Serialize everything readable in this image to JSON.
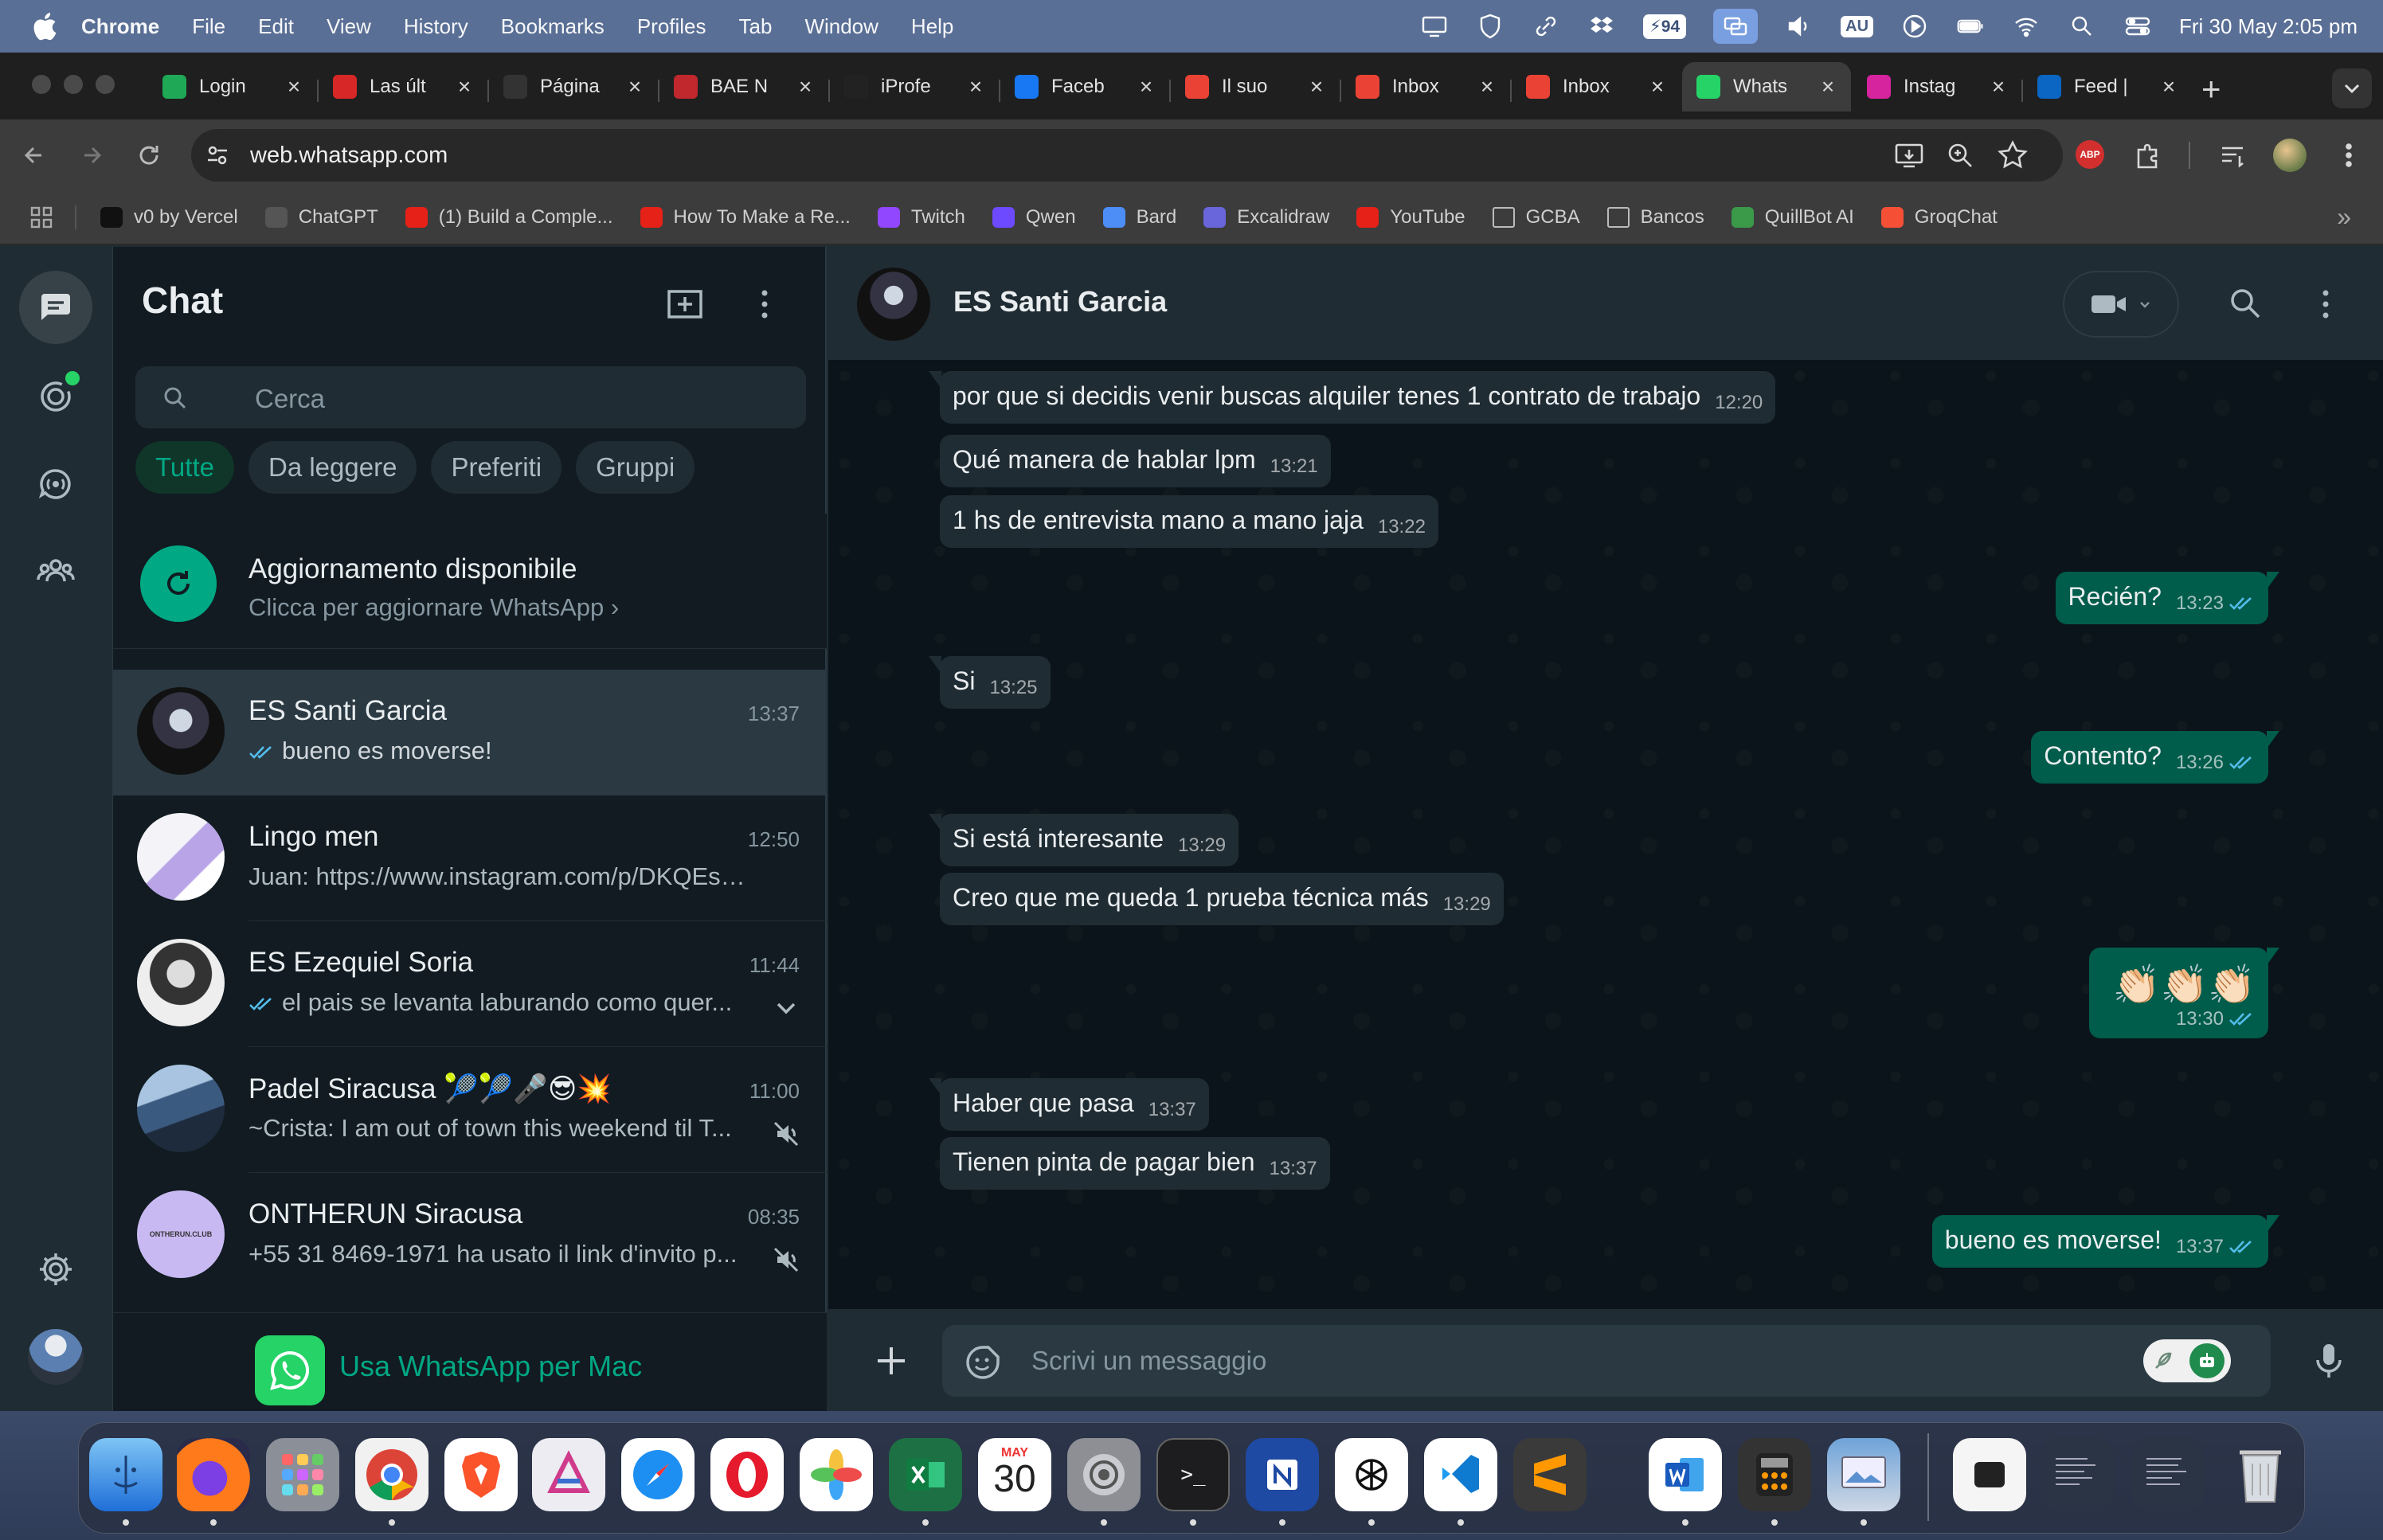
{
  "menubar": {
    "app": "Chrome",
    "items": [
      "File",
      "Edit",
      "View",
      "History",
      "Bookmarks",
      "Profiles",
      "Tab",
      "Window",
      "Help"
    ],
    "battery": "94",
    "input_source": "AU",
    "clock": "Fri 30 May  2:05 pm"
  },
  "tabs": [
    {
      "title": "Login",
      "icon": "evernote-icon",
      "color": "#1fa855"
    },
    {
      "title": "Las últ",
      "icon": "ml-icon",
      "color": "#d72727"
    },
    {
      "title": "Página",
      "icon": "pagina12-icon",
      "color": "#333333"
    },
    {
      "title": "BAE N",
      "icon": "bae-icon",
      "color": "#c0282d"
    },
    {
      "title": "iProfe",
      "icon": "iprofesional-icon",
      "color": "#222222"
    },
    {
      "title": "Faceb",
      "icon": "facebook-icon",
      "color": "#1877f2"
    },
    {
      "title": "Il suo",
      "icon": "gmail-icon",
      "color": "#ea4335"
    },
    {
      "title": "Inbox",
      "icon": "gmail-icon",
      "color": "#ea4335"
    },
    {
      "title": "Inbox",
      "icon": "gmail-icon",
      "color": "#ea4335"
    },
    {
      "title": "Whats",
      "icon": "whatsapp-icon",
      "color": "#25d366",
      "active": true
    },
    {
      "title": "Instag",
      "icon": "instagram-icon",
      "color": "#d6249f"
    },
    {
      "title": "Feed |",
      "icon": "linkedin-icon",
      "color": "#0a66c2"
    }
  ],
  "omnibox": {
    "url": "web.whatsapp.com"
  },
  "bookmarks": [
    {
      "label": "v0 by Vercel",
      "color": "#111111"
    },
    {
      "label": "ChatGPT",
      "color": "#555555"
    },
    {
      "label": "(1) Build a Comple...",
      "color": "#e62117"
    },
    {
      "label": "How To Make a Re...",
      "color": "#e62117"
    },
    {
      "label": "Twitch",
      "color": "#9146ff"
    },
    {
      "label": "Qwen",
      "color": "#6d4aff"
    },
    {
      "label": "Bard",
      "color": "#4c8df6"
    },
    {
      "label": "Excalidraw",
      "color": "#6965db"
    },
    {
      "label": "YouTube",
      "color": "#e62117"
    },
    {
      "label": "GCBA",
      "color": "folder"
    },
    {
      "label": "Bancos",
      "color": "folder"
    },
    {
      "label": "QuillBot AI",
      "color": "#3a9a4a"
    },
    {
      "label": "GroqChat",
      "color": "#f55036"
    }
  ],
  "sidebar": {
    "title": "Chat",
    "search_placeholder": "Cerca",
    "filters": [
      "Tutte",
      "Da leggere",
      "Preferiti",
      "Gruppi"
    ],
    "update": {
      "title": "Aggiornamento disponibile",
      "subtitle": "Clicca per aggiornare WhatsApp"
    },
    "chats": [
      {
        "name": "ES Santi Garcia",
        "time": "13:37",
        "preview": "bueno es moverse!",
        "ticks": true
      },
      {
        "name": "Lingo men",
        "time": "12:50",
        "preview": "Juan: https://www.instagram.com/p/DKQEsbB..."
      },
      {
        "name": "ES Ezequiel Soria",
        "time": "11:44",
        "preview": "el pais se levanta laburando como quer...",
        "ticks": true
      },
      {
        "name": "Padel Siracusa",
        "name_emoji": "🎾🎾🎤😎💥",
        "time": "11:00",
        "preview": "~Crista: I am out of town this weekend til T..."
      },
      {
        "name": "ONTHERUN Siracusa",
        "time": "08:35",
        "preview": "+55 31 8469-1971 ha usato il link d'invito p..."
      }
    ],
    "get_mac": "Usa WhatsApp per Mac"
  },
  "conversation": {
    "contact": "ES Santi Garcia",
    "messages": [
      {
        "dir": "in",
        "text": "por que si decidis venir buscas alquiler tenes 1 contrato de trabajo",
        "time": "12:20"
      },
      {
        "dir": "in",
        "text": "Qué manera de hablar lpm",
        "time": "13:21"
      },
      {
        "dir": "in",
        "text": "1 hs de entrevista mano a mano jaja",
        "time": "13:22"
      },
      {
        "dir": "out",
        "text": "Recién?",
        "time": "13:23"
      },
      {
        "dir": "in",
        "text": "Si",
        "time": "13:25"
      },
      {
        "dir": "out",
        "text": "Contento?",
        "time": "13:26"
      },
      {
        "dir": "in",
        "text": "Si está interesante",
        "time": "13:29"
      },
      {
        "dir": "in",
        "text": "Creo que me queda 1 prueba técnica más",
        "time": "13:29"
      },
      {
        "dir": "out",
        "text": "👏🏻👏🏻👏🏻",
        "time": "13:30"
      },
      {
        "dir": "in",
        "text": "Haber que pasa",
        "time": "13:37"
      },
      {
        "dir": "in",
        "text": "Tienen pinta de pagar bien",
        "time": "13:37"
      },
      {
        "dir": "out",
        "text": "bueno es moverse!",
        "time": "13:37"
      }
    ],
    "composer_placeholder": "Scrivi un messaggio"
  },
  "calendar_dock": {
    "month": "MAY",
    "day": "30"
  },
  "colors": {
    "accent": "#00a884",
    "out_bubble": "#005c4b",
    "in_bubble": "#202c33",
    "panel": "#111b21"
  }
}
